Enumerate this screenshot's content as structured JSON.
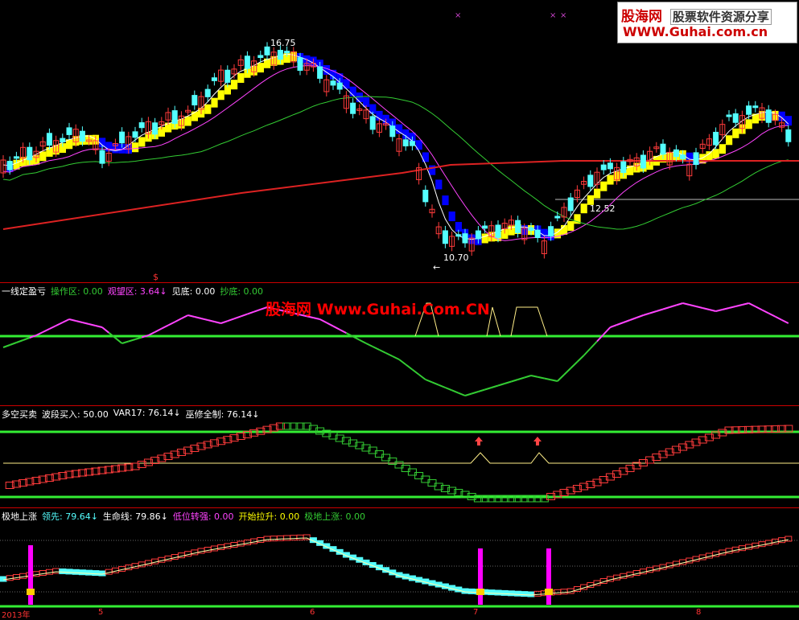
{
  "watermark": {
    "brand": "股海网",
    "slogan": "股票软件资源分享",
    "url": "WWW.Guhai.com.cn",
    "center_text": "股海网 Www.Guhai.Com.CN"
  },
  "colors": {
    "background": "#000000",
    "bull": "#ff3b3b",
    "bear": "#54ffff",
    "band_up": "#ffff00",
    "band_down": "#0000ff",
    "ma_white": "#ffffff",
    "ma_magenta": "#ff44ff",
    "ma_green": "#33cc33",
    "ma_red": "#dd2222"
  },
  "main_chart": {
    "high_label": "16.75",
    "low_label": "10.70",
    "level_label": "12.52",
    "left_arrow_label": "←",
    "marker_top": [
      "×",
      "×",
      "×"
    ]
  },
  "panel1": {
    "title": "一线定盈亏",
    "items": [
      {
        "label": "操作区:",
        "value": "0.00",
        "color": "#33cc33"
      },
      {
        "label": "观望区:",
        "value": "3.64↓",
        "color": "#ff44ff"
      },
      {
        "label": "见底:",
        "value": "0.00",
        "color": "#ffffff"
      },
      {
        "label": "抄底:",
        "value": "0.00",
        "color": "#33cc33"
      }
    ],
    "marker": "$"
  },
  "panel2": {
    "title": "多空买卖",
    "items": [
      {
        "label": "波段买入:",
        "value": "50.00",
        "color": "#ffffff"
      },
      {
        "label": "VAR17:",
        "value": "76.14↓",
        "color": "#ffffff"
      },
      {
        "label": "巫修全制:",
        "value": "76.14↓",
        "color": "#ffffff"
      }
    ]
  },
  "panel3": {
    "title": "极地上涨",
    "items": [
      {
        "label": "领先:",
        "value": "79.64↓",
        "color": "#54ffff"
      },
      {
        "label": "生命线:",
        "value": "79.86↓",
        "color": "#ffffff"
      },
      {
        "label": "低位转强:",
        "value": "0.00",
        "color": "#ff44ff"
      },
      {
        "label": "开始拉升:",
        "value": "0.00",
        "color": "#ffff00"
      },
      {
        "label": "极地上涨:",
        "value": "0.00",
        "color": "#33cc33"
      }
    ]
  },
  "x_axis": {
    "labels": [
      "2013年",
      "5",
      "6",
      "7",
      "8"
    ]
  }
}
